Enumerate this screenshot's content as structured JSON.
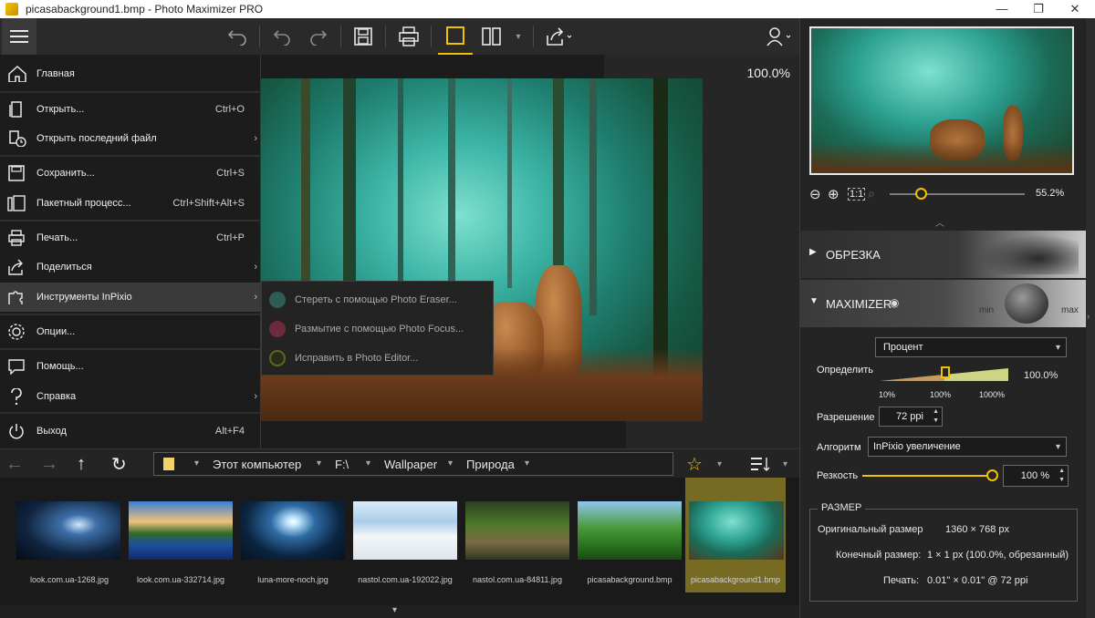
{
  "window": {
    "title": "picasabackground1.bmp - Photo Maximizer PRO",
    "minimize": "—",
    "maximize": "❐",
    "close": "✕"
  },
  "canvas": {
    "zoom": "100.0%"
  },
  "menu": {
    "items": [
      {
        "label": "Главная",
        "shortcut": "",
        "submenu": false
      },
      {
        "label": "Открыть...",
        "shortcut": "Ctrl+O",
        "submenu": false
      },
      {
        "label": "Открыть последний файл",
        "shortcut": "",
        "submenu": true
      },
      {
        "label": "Сохранить...",
        "shortcut": "Ctrl+S",
        "submenu": false
      },
      {
        "label": "Пакетный процесс...",
        "shortcut": "Ctrl+Shift+Alt+S",
        "submenu": false
      },
      {
        "label": "Печать...",
        "shortcut": "Ctrl+P",
        "submenu": false
      },
      {
        "label": "Поделиться",
        "shortcut": "",
        "submenu": true
      },
      {
        "label": "Инструменты InPixio",
        "shortcut": "",
        "submenu": true
      },
      {
        "label": "Опции...",
        "shortcut": "",
        "submenu": false
      },
      {
        "label": "Помощь...",
        "shortcut": "",
        "submenu": false
      },
      {
        "label": "Справка",
        "shortcut": "",
        "submenu": true
      },
      {
        "label": "Выход",
        "shortcut": "Alt+F4",
        "submenu": false
      }
    ],
    "arrow": "›"
  },
  "submenu": {
    "items": [
      {
        "label": "Стереть с помощью Photo Eraser...",
        "icon": "eraser-icon",
        "color": "#3d7a6e"
      },
      {
        "label": "Размытие с помощью Photo Focus...",
        "icon": "heart-icon",
        "color": "#a03a55"
      },
      {
        "label": "Исправить в Photo Editor...",
        "icon": "circle-icon",
        "color": "#6f7a2a"
      }
    ]
  },
  "pathbar": {
    "segments": [
      "Этот компьютер",
      "F:\\",
      "Wallpaper",
      "Природа"
    ]
  },
  "thumbnails": [
    {
      "name": "look.com.ua-1268.jpg"
    },
    {
      "name": "look.com.ua-332714.jpg"
    },
    {
      "name": "luna-more-noch.jpg"
    },
    {
      "name": "nastol.com.ua-192022.jpg"
    },
    {
      "name": "nastol.com.ua-84811.jpg"
    },
    {
      "name": "picasabackground.bmp"
    },
    {
      "name": "picasabackground1.bmp",
      "selected": true
    }
  ],
  "navigator": {
    "zoom": "55.2%",
    "one_to_one": "1:1",
    "zoom_level": 0.23
  },
  "sections": {
    "crop": "ОБРЕЗКА",
    "maximizer": "MAXIMIZER",
    "min": "min",
    "max": "max"
  },
  "maximizer": {
    "mode_value": "Процент",
    "determine_label": "Определить",
    "determine_value": "100.0%",
    "scale_ticks": [
      "10%",
      "100%",
      "1000%"
    ],
    "resolution_label": "Разрешение",
    "resolution_value": "72 ppi",
    "algorithm_label": "Алгоритм",
    "algorithm_value": "InPixio увеличение",
    "sharpness_label": "Резкость",
    "sharpness_value": "100 %",
    "sharpness_level": 1.0
  },
  "size": {
    "title": "РАЗМЕР",
    "original_label": "Оригинальный размер",
    "original_value": "1360 × 768 px",
    "final_label": "Конечный размер:",
    "final_value": "1 × 1 px (100.0%, обрезанный)",
    "print_label": "Печать:",
    "print_value": "0.01\" × 0.01\" @ 72 ppi"
  },
  "colors": {
    "accent": "#f2c200",
    "menu_bg": "#1c1c1c",
    "panel_bg": "#242424"
  }
}
